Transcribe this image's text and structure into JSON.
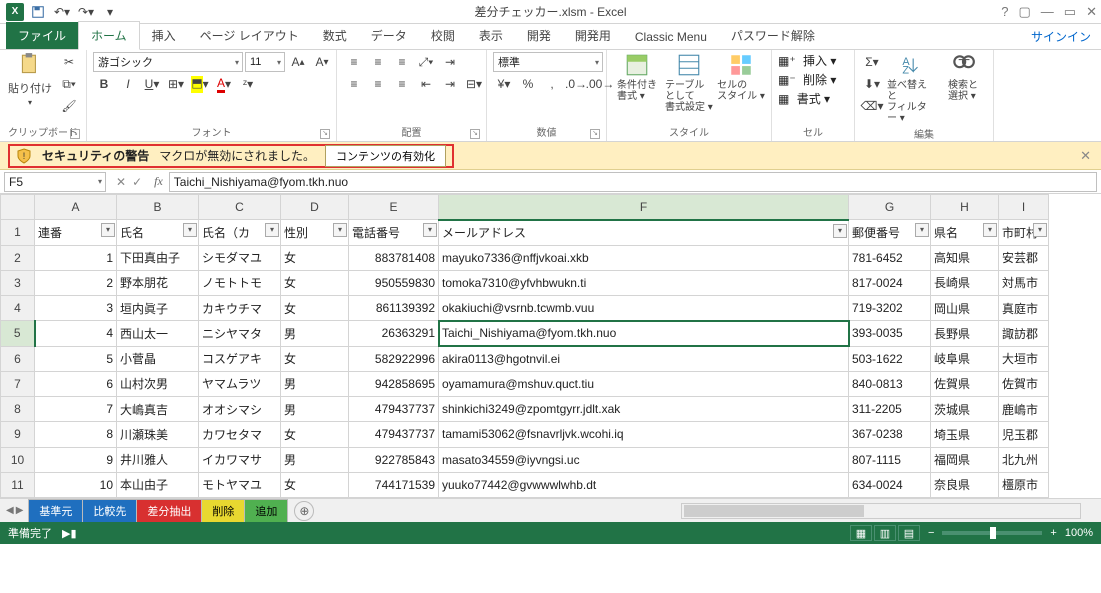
{
  "title": "差分チェッカー.xlsm - Excel",
  "signin": "サインイン",
  "tabs": {
    "file": "ファイル",
    "home": "ホーム",
    "insert": "挿入",
    "layout": "ページ レイアウト",
    "formula": "数式",
    "data": "データ",
    "review": "校閲",
    "view": "表示",
    "dev": "開発",
    "dev2": "開発用",
    "classic": "Classic Menu",
    "pwd": "パスワード解除"
  },
  "ribbon": {
    "clipboard": {
      "label": "クリップボード",
      "paste": "貼り付け"
    },
    "font": {
      "label": "フォント",
      "name": "游ゴシック",
      "size": "11"
    },
    "align": {
      "label": "配置"
    },
    "number": {
      "label": "数値",
      "format": "標準"
    },
    "styles": {
      "label": "スタイル",
      "cond": "条件付き\n書式 ▾",
      "table": "テーブルとして\n書式設定 ▾",
      "cell": "セルの\nスタイル ▾"
    },
    "cells": {
      "label": "セル",
      "insert": "挿入 ▾",
      "delete": "削除 ▾",
      "format": "書式 ▾"
    },
    "editing": {
      "label": "編集",
      "sort": "並べ替えと\nフィルター ▾",
      "find": "検索と\n選択 ▾"
    }
  },
  "security": {
    "title": "セキュリティの警告",
    "msg": "マクロが無効にされました。",
    "btn": "コンテンツの有効化"
  },
  "namebox": "F5",
  "formula": "Taichi_Nishiyama@fyom.tkh.nuo",
  "columns": [
    "A",
    "B",
    "C",
    "D",
    "E",
    "F",
    "G",
    "H",
    "I"
  ],
  "headers": {
    "A": "連番",
    "B": "氏名",
    "C": "氏名（カ",
    "D": "性別",
    "E": "電話番号",
    "F": "メールアドレス",
    "G": "郵便番号",
    "H": "県名",
    "I": "市町村"
  },
  "rows": [
    {
      "n": 1,
      "A": "1",
      "B": "下田真由子",
      "C": "シモダマユ",
      "D": "女",
      "E": "883781408",
      "F": "mayuko7336@nffjvkoai.xkb",
      "G": "781-6452",
      "H": "高知県",
      "I": "安芸郡"
    },
    {
      "n": 2,
      "A": "2",
      "B": "野本朋花",
      "C": "ノモトトモ",
      "D": "女",
      "E": "950559830",
      "F": "tomoka7310@yfvhbwukn.ti",
      "G": "817-0024",
      "H": "長崎県",
      "I": "対馬市"
    },
    {
      "n": 3,
      "A": "3",
      "B": "垣内眞子",
      "C": "カキウチマ",
      "D": "女",
      "E": "861139392",
      "F": "okakiuchi@vsrnb.tcwmb.vuu",
      "G": "719-3202",
      "H": "岡山県",
      "I": "真庭市"
    },
    {
      "n": 4,
      "A": "4",
      "B": "西山太一",
      "C": "ニシヤマタ",
      "D": "男",
      "E": "26363291",
      "F": "Taichi_Nishiyama@fyom.tkh.nuo",
      "G": "393-0035",
      "H": "長野県",
      "I": "諏訪郡"
    },
    {
      "n": 5,
      "A": "5",
      "B": "小菅晶",
      "C": "コスゲアキ",
      "D": "女",
      "E": "582922996",
      "F": "akira0113@hgotnvil.ei",
      "G": "503-1622",
      "H": "岐阜県",
      "I": "大垣市"
    },
    {
      "n": 6,
      "A": "6",
      "B": "山村次男",
      "C": "ヤマムラツ",
      "D": "男",
      "E": "942858695",
      "F": "oyamamura@mshuv.quct.tiu",
      "G": "840-0813",
      "H": "佐賀県",
      "I": "佐賀市"
    },
    {
      "n": 7,
      "A": "7",
      "B": "大嶋真吉",
      "C": "オオシマシ",
      "D": "男",
      "E": "479437737",
      "F": "shinkichi3249@zpomtgyrr.jdlt.xak",
      "G": "311-2205",
      "H": "茨城県",
      "I": "鹿嶋市"
    },
    {
      "n": 8,
      "A": "8",
      "B": "川瀬珠美",
      "C": "カワセタマ",
      "D": "女",
      "E": "479437737",
      "F": "tamami53062@fsnavrljvk.wcohi.iq",
      "G": "367-0238",
      "H": "埼玉県",
      "I": "児玉郡"
    },
    {
      "n": 9,
      "A": "9",
      "B": "井川雅人",
      "C": "イカワマサ",
      "D": "男",
      "E": "922785843",
      "F": "masato34559@iyvngsi.uc",
      "G": "807-1115",
      "H": "福岡県",
      "I": "北九州"
    },
    {
      "n": 10,
      "A": "10",
      "B": "本山由子",
      "C": "モトヤマユ",
      "D": "女",
      "E": "744171539",
      "F": "yuuko77442@gvwwwlwhb.dt",
      "G": "634-0024",
      "H": "奈良県",
      "I": "橿原市"
    }
  ],
  "selected": {
    "row": 5,
    "col": "F"
  },
  "sheets": [
    {
      "name": "基準元",
      "cls": "c1"
    },
    {
      "name": "比較先",
      "cls": "c2"
    },
    {
      "name": "差分抽出",
      "cls": "c3"
    },
    {
      "name": "削除",
      "cls": "c4"
    },
    {
      "name": "追加",
      "cls": "c5"
    }
  ],
  "status": {
    "ready": "準備完了",
    "macro": "🔲",
    "zoom": "100%"
  }
}
